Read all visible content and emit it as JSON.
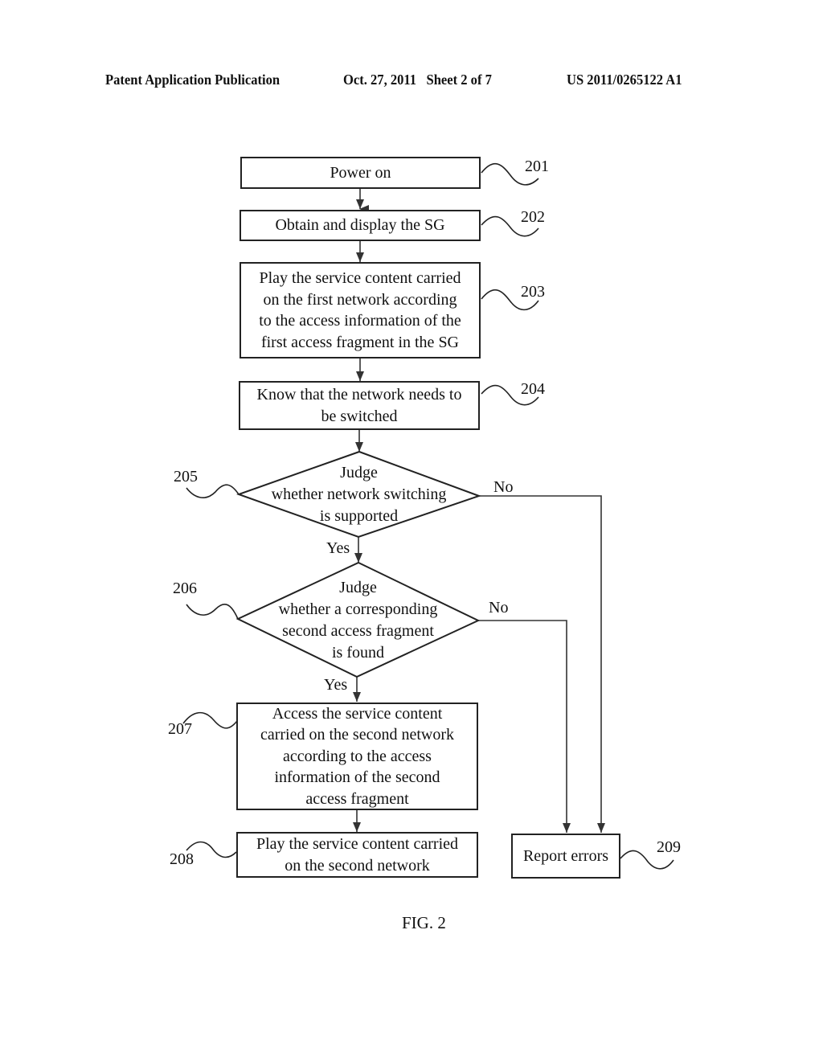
{
  "header": {
    "publication": "Patent Application Publication",
    "date_sheet": "Oct. 27, 2011   Sheet 2 of 7",
    "number": "US 2011/0265122 A1"
  },
  "steps": [
    {
      "ref": "201",
      "text": "Power on"
    },
    {
      "ref": "202",
      "text": "Obtain and display the SG"
    },
    {
      "ref": "203",
      "lines": [
        "Play the service content carried",
        "on the first network according",
        "to the access information of the",
        "first access fragment in the SG"
      ]
    },
    {
      "ref": "204",
      "lines": [
        "Know that the network needs to",
        "be switched"
      ]
    },
    {
      "ref": "205",
      "lines": [
        "Judge",
        "whether network switching",
        "is supported"
      ]
    },
    {
      "ref": "206",
      "lines": [
        "Judge",
        "whether a corresponding",
        "second access fragment",
        "is found"
      ]
    },
    {
      "ref": "207",
      "lines": [
        "Access the service content",
        "carried on the second network",
        "according to the access",
        "information of the second",
        "access fragment"
      ]
    },
    {
      "ref": "208",
      "lines": [
        "Play the service content carried",
        "on the second network"
      ]
    },
    {
      "ref": "209",
      "text": "Report errors"
    }
  ],
  "branches": {
    "d205_yes": "Yes",
    "d205_no": "No",
    "d206_yes": "Yes",
    "d206_no": "No"
  },
  "figure_label": "FIG. 2"
}
